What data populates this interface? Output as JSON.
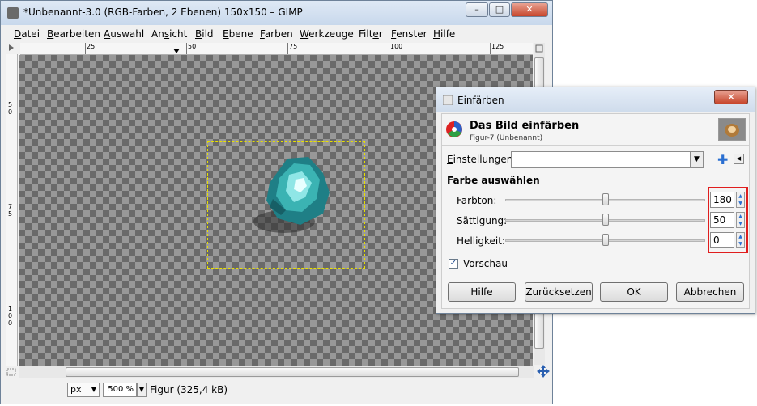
{
  "main_window": {
    "title": "*Unbenannt-3.0 (RGB-Farben, 2 Ebenen) 150x150 – GIMP",
    "controls": {
      "minimize": "–",
      "maximize": "□",
      "close": "✕"
    },
    "menu": [
      {
        "hot": "D",
        "rest": "atei"
      },
      {
        "hot": "B",
        "rest": "earbeiten"
      },
      {
        "hot": "A",
        "rest": "uswahl"
      },
      {
        "pre": "An",
        "hot": "s",
        "rest": "icht"
      },
      {
        "hot": "B",
        "rest": "ild"
      },
      {
        "hot": "E",
        "rest": "bene"
      },
      {
        "hot": "F",
        "rest": "arben"
      },
      {
        "hot": "W",
        "rest": "erkzeuge"
      },
      {
        "pre": "Filt",
        "hot": "e",
        "rest": "r"
      },
      {
        "hot": "F",
        "rest": "enster"
      },
      {
        "hot": "H",
        "rest": "ilfe"
      }
    ],
    "ruler_h_labels": [
      "25",
      "50",
      "75",
      "100",
      "125"
    ],
    "ruler_v_labels": [
      "5\n0",
      "7\n5",
      "1\n0\n0"
    ],
    "status": {
      "unit": "px",
      "zoom": "500 %",
      "info": "Figur (325,4 kB)"
    }
  },
  "dialog": {
    "title": "Einfärben",
    "heading": "Das Bild einfärben",
    "subheading": "Figur-7 (Unbenannt)",
    "settings_label": "Einstellungen:",
    "settings_value": "",
    "section_title": "Farbe auswählen",
    "fields": [
      {
        "label": "Farbton:",
        "value": "180",
        "fraction": 0.5
      },
      {
        "label": "Sättigung:",
        "value": "50",
        "fraction": 0.5
      },
      {
        "label": "Helligkeit:",
        "value": "0",
        "fraction": 0.5
      }
    ],
    "preview_label": "Vorschau",
    "preview_checked": true,
    "buttons": {
      "help": "Hilfe",
      "reset": "Zurücksetzen",
      "ok": "OK",
      "cancel": "Abbrechen"
    }
  },
  "colors": {
    "highlight_border": "#e01e1e",
    "selection_marquee": "#e8e000",
    "figure_main": "#3bb3b3"
  }
}
